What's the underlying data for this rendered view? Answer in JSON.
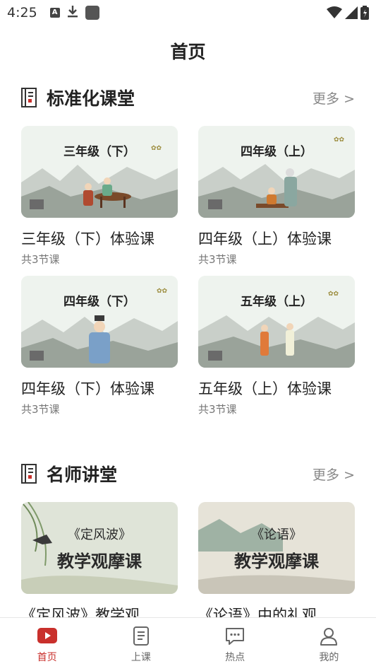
{
  "status_bar": {
    "time": "4:25",
    "icons": [
      "a-notification-icon",
      "download-icon",
      "app-square-icon",
      "wifi-icon",
      "signal-icon",
      "battery-icon"
    ]
  },
  "header": {
    "title": "首页"
  },
  "sections": [
    {
      "title": "标准化课堂",
      "more": "更多 >",
      "cards": [
        {
          "thumb_title": "三年级（下）",
          "title": "三年级（下）体验课",
          "subtitle": "共3节课"
        },
        {
          "thumb_title": "四年级（上）",
          "title": "四年级（上）体验课",
          "subtitle": "共3节课"
        },
        {
          "thumb_title": "四年级（下）",
          "title": "四年级（下）体验课",
          "subtitle": "共3节课"
        },
        {
          "thumb_title": "五年级（上）",
          "title": "五年级（上）体验课",
          "subtitle": "共3节课"
        }
      ]
    },
    {
      "title": "名师讲堂",
      "more": "更多 >",
      "cards": [
        {
          "thumb_line1": "《定风波》",
          "thumb_line2": "教学观摩课",
          "title": "《定风波》教学观"
        },
        {
          "thumb_line1": "《论语》",
          "thumb_line2": "教学观摩课",
          "title": "《论语》中的礼观"
        }
      ]
    }
  ],
  "bottom_nav": [
    {
      "label": "首页",
      "icon": "play-home-icon",
      "active": true
    },
    {
      "label": "上课",
      "icon": "book-icon",
      "active": false
    },
    {
      "label": "热点",
      "icon": "chat-bubble-icon",
      "active": false
    },
    {
      "label": "我的",
      "icon": "user-icon",
      "active": false
    }
  ],
  "colors": {
    "accent": "#c9302c",
    "text": "#222222",
    "muted": "#888888"
  }
}
